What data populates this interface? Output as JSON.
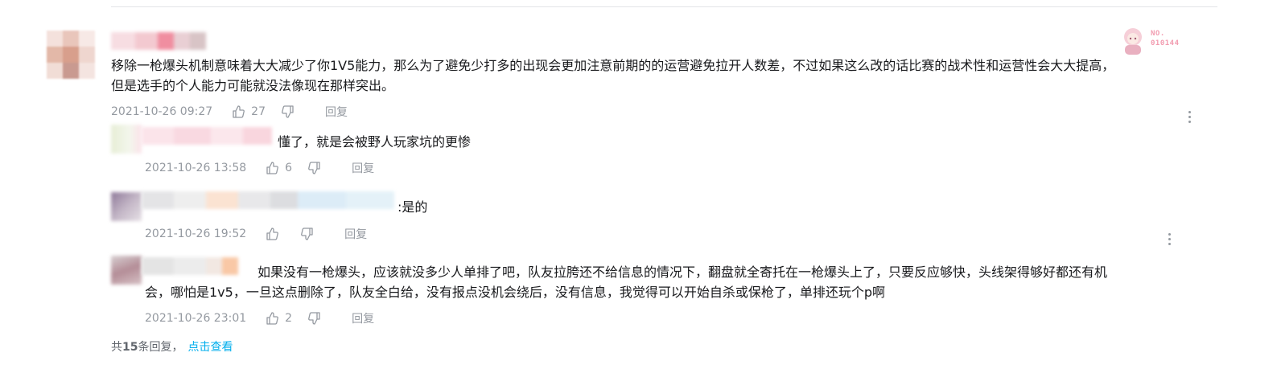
{
  "main_comment": {
    "line1": "移除一枪爆头机制意味着大大减少了你1V5能力，那么为了避免少打多的出现会更加注意前期的的运营避免拉开人数差，不过如果这么改的话比赛的战术性和运营性会大大提高，",
    "line2": "但是选手的个人能力可能就没法像现在那样突出。",
    "time": "2021-10-26 09:27",
    "likes": "27",
    "reply_label": "回复",
    "badge_no": "NO.",
    "badge_num": "010144"
  },
  "replies": [
    {
      "text": "懂了，就是会被野人玩家坑的更惨",
      "time": "2021-10-26 13:58",
      "likes": "6",
      "reply_label": "回复"
    },
    {
      "text": ":是的",
      "time": "2021-10-26 19:52",
      "likes": "",
      "reply_label": "回复"
    },
    {
      "line1": "如果没有一枪爆头，应该就没多少人单排了吧，队友拉胯还不给信息的情况下，翻盘就全寄托在一枪爆头上了，只要反应够快，头线架得够好都还有机",
      "line2": "会，哪怕是1v5，一旦这点删除了，队友全白给，没有报点没机会绕后，没有信息，我觉得可以开始自杀或保枪了，单排还玩个p啊",
      "time": "2021-10-26 23:01",
      "likes": "2",
      "reply_label": "回复"
    }
  ],
  "footer": {
    "prefix": "共",
    "count": "15",
    "suffix": "条回复，",
    "link": "点击查看"
  },
  "icons": {
    "like": "thumbs-up-icon",
    "dislike": "thumbs-down-icon",
    "more": "more-vertical-icon"
  },
  "colors": {
    "meta": "#9499a0",
    "link": "#00aeec",
    "badge": "#f29cb0"
  }
}
